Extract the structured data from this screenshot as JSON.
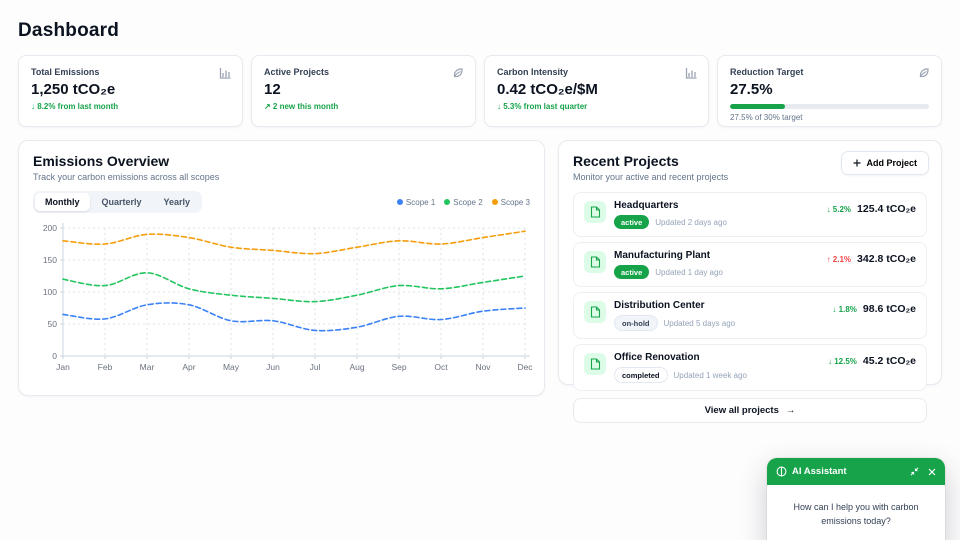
{
  "page": {
    "title": "Dashboard"
  },
  "colors": {
    "positive": "#16a34a",
    "negative": "#ef4444",
    "accent_green": "#16a34a",
    "scope1": "#3b82f6",
    "scope2": "#22c55e",
    "scope3": "#f59e0b"
  },
  "stats": [
    {
      "label": "Total Emissions",
      "value": "1,250 tCO₂e",
      "delta": "↓ 8.2% from last month",
      "icon": "bar-chart"
    },
    {
      "label": "Active Projects",
      "value": "12",
      "delta": "↗ 2 new this month",
      "icon": "leaf"
    },
    {
      "label": "Carbon Intensity",
      "value": "0.42 tCO₂e/$M",
      "delta": "↓ 5.3% from last quarter",
      "icon": "bar-chart"
    },
    {
      "label": "Reduction Target",
      "value": "27.5%",
      "progress_pct": 27.5,
      "progress_caption": "27.5% of 30% target",
      "icon": "leaf"
    }
  ],
  "emissions": {
    "tabs": [
      {
        "label": "Monthly",
        "active": true
      },
      {
        "label": "Quarterly",
        "active": false
      },
      {
        "label": "Yearly",
        "active": false
      }
    ]
  },
  "chart_data": {
    "type": "line",
    "title": "Emissions Overview",
    "subtitle": "Track your carbon emissions across all scopes",
    "categories": [
      "Jan",
      "Feb",
      "Mar",
      "Apr",
      "May",
      "Jun",
      "Jul",
      "Aug",
      "Sep",
      "Oct",
      "Nov",
      "Dec"
    ],
    "series": [
      {
        "name": "Scope 1",
        "color": "#3b82f6",
        "values": [
          65,
          58,
          80,
          80,
          55,
          55,
          40,
          45,
          62,
          57,
          70,
          75
        ]
      },
      {
        "name": "Scope 2",
        "color": "#22c55e",
        "values": [
          120,
          110,
          130,
          105,
          95,
          90,
          85,
          95,
          110,
          105,
          115,
          125
        ]
      },
      {
        "name": "Scope 3",
        "color": "#f59e0b",
        "values": [
          180,
          175,
          190,
          185,
          170,
          165,
          160,
          170,
          180,
          175,
          185,
          195
        ]
      }
    ],
    "xlabel": "",
    "ylabel": "",
    "ylim": [
      0,
      200
    ],
    "yticks": [
      0,
      50,
      100,
      150,
      200
    ],
    "grid": true,
    "legend_position": "top-right"
  },
  "projects": {
    "title": "Recent Projects",
    "subtitle": "Monitor your active and recent projects",
    "add_button": "Add Project",
    "view_all": "View all projects",
    "view_all_arrow": "→",
    "items": [
      {
        "name": "Headquarters",
        "status": "active",
        "updated": "Updated 2 days ago",
        "delta": "↓ 5.2%",
        "trend": "down",
        "value": "125.4 tCO₂e"
      },
      {
        "name": "Manufacturing Plant",
        "status": "active",
        "updated": "Updated 1 day ago",
        "delta": "↑ 2.1%",
        "trend": "up",
        "value": "342.8 tCO₂e"
      },
      {
        "name": "Distribution Center",
        "status": "on-hold",
        "updated": "Updated 5 days ago",
        "delta": "↓ 1.8%",
        "trend": "down",
        "value": "98.6 tCO₂e"
      },
      {
        "name": "Office Renovation",
        "status": "completed",
        "updated": "Updated 1 week ago",
        "delta": "↓ 12.5%",
        "trend": "down",
        "value": "45.2 tCO₂e"
      }
    ]
  },
  "assistant": {
    "title": "AI Assistant",
    "message": "How can I help you with carbon emissions today?"
  }
}
